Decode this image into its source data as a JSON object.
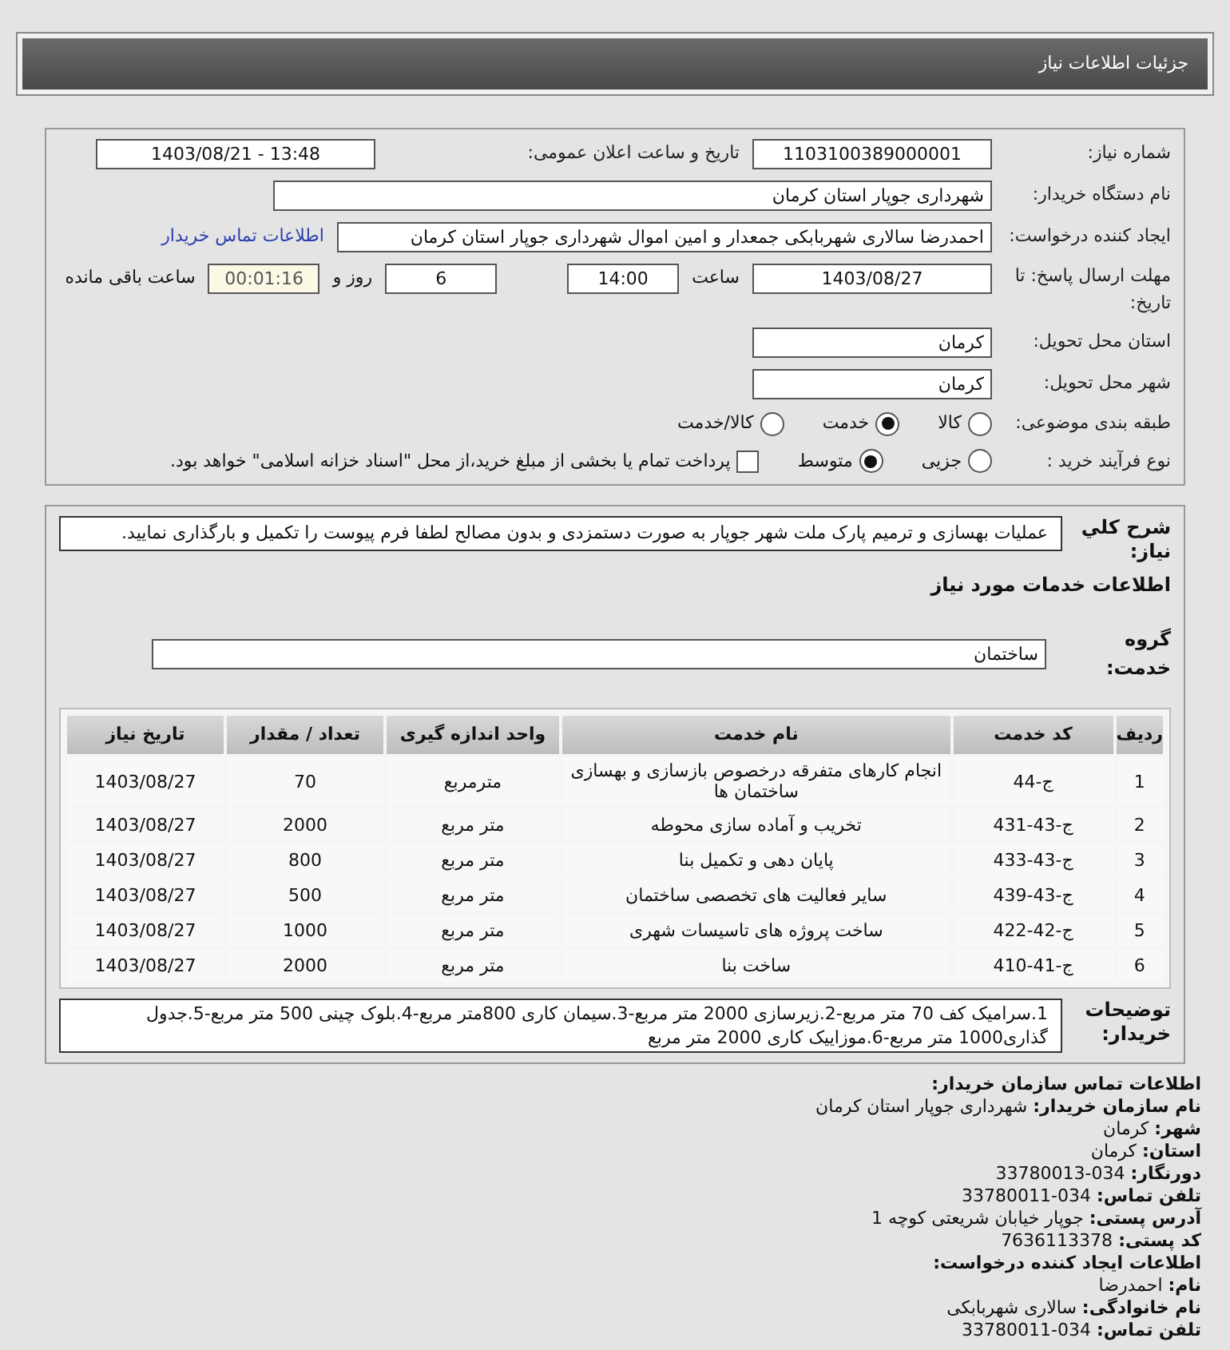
{
  "header": {
    "title": "جزئیات اطلاعات نیاز"
  },
  "need_number": {
    "label": "شماره نیاز:",
    "value": "1103100389000001"
  },
  "announce": {
    "label": "تاریخ و ساعت اعلان عمومی:",
    "value": "1403/08/21 - 13:48"
  },
  "buyer_org": {
    "label": "نام دستگاه خریدار:",
    "value": "شهرداری جوپار استان کرمان"
  },
  "requester": {
    "label": "ایجاد کننده درخواست:",
    "value": "احمدرضا  سالاری شهربابکی جمعدار و امین اموال شهرداری جوپار استان کرمان",
    "link": "اطلاعات تماس خریدار"
  },
  "deadline": {
    "label": "مهلت ارسال پاسخ: تا تاریخ:",
    "date": "1403/08/27",
    "time_label": "ساعت",
    "time": "14:00",
    "days": "6",
    "days_label": "روز و",
    "remaining": "00:01:16",
    "remaining_label": "ساعت باقی مانده"
  },
  "province": {
    "label": "استان محل تحویل:",
    "value": "کرمان"
  },
  "city": {
    "label": "شهر محل تحویل:",
    "value": "کرمان"
  },
  "category": {
    "label": "طبقه بندی موضوعی:",
    "options": [
      {
        "label": "کالا",
        "selected": false
      },
      {
        "label": "خدمت",
        "selected": true
      },
      {
        "label": "کالا/خدمت",
        "selected": false
      }
    ]
  },
  "process": {
    "label": "نوع فرآیند خرید :",
    "options": [
      {
        "label": "جزیی",
        "selected": false
      },
      {
        "label": "متوسط",
        "selected": true
      }
    ],
    "checkbox": {
      "label": "پرداخت تمام یا بخشی از مبلغ خرید،از محل \"اسناد خزانه اسلامی\" خواهد بود.",
      "checked": false
    }
  },
  "summary": {
    "label": "شرح کلي نياز:",
    "value": "عملیات بهسازی و ترمیم پارک ملت شهر جوپار به صورت دستمزدی و بدون مصالح لطفا فرم پیوست را تکمیل و بارگذاری نمایید."
  },
  "services_title": "اطلاعات خدمات مورد نیاز",
  "service_group": {
    "label": "گروه خدمت:",
    "value": "ساختمان"
  },
  "table": {
    "columns": [
      "ردیف",
      "کد خدمت",
      "نام خدمت",
      "واحد اندازه گیری",
      "تعداد / مقدار",
      "تاریخ نیاز"
    ],
    "rows": [
      [
        "1",
        "ج-44",
        "انجام کارهای متفرقه درخصوص بازسازی و بهسازی ساختمان ها",
        "مترمربع",
        "70",
        "1403/08/27"
      ],
      [
        "2",
        "ج-43-431",
        "تخریب و آماده سازی محوطه",
        "متر مربع",
        "2000",
        "1403/08/27"
      ],
      [
        "3",
        "ج-43-433",
        "پایان دهی و تکمیل بنا",
        "متر مربع",
        "800",
        "1403/08/27"
      ],
      [
        "4",
        "ج-43-439",
        "سایر فعالیت های تخصصی ساختمان",
        "متر مربع",
        "500",
        "1403/08/27"
      ],
      [
        "5",
        "ج-42-422",
        "ساخت پروژه های تاسیسات شهری",
        "متر مربع",
        "1000",
        "1403/08/27"
      ],
      [
        "6",
        "ج-41-410",
        "ساخت بنا",
        "متر مربع",
        "2000",
        "1403/08/27"
      ]
    ]
  },
  "buyer_notes": {
    "label": "توضیحات خریدار:",
    "value": "1.سرامیک کف 70 متر مربع-2.زیرسازی 2000 متر مربع-3.سیمان کاری 800متر مربع-4.بلوک چینی 500 متر مربع-5.جدول گذاری1000 متر مربع-6.موزاییک کاری 2000 متر مربع"
  },
  "contact": {
    "title": "اطلاعات تماس سازمان خریدار:",
    "lines": [
      {
        "label": "نام سازمان خریدار:",
        "value": "شهرداری جوپار استان کرمان"
      },
      {
        "label": "شهر:",
        "value": "کرمان"
      },
      {
        "label": "استان:",
        "value": "کرمان"
      },
      {
        "label": "دورنگار:",
        "value": "034-33780013"
      },
      {
        "label": "تلفن تماس:",
        "value": "034-33780011"
      },
      {
        "label": "آدرس پستی:",
        "value": "جوپار خیابان شریعتی کوچه 1"
      },
      {
        "label": "کد پستی:",
        "value": "7636113378"
      }
    ],
    "creator_title": "اطلاعات ایجاد کننده درخواست:",
    "creator_lines": [
      {
        "label": "نام:",
        "value": "احمدرضا"
      },
      {
        "label": "نام خانوادگی:",
        "value": "سالاری شهربابکی"
      },
      {
        "label": "تلفن تماس:",
        "value": "034-33780011"
      }
    ]
  }
}
